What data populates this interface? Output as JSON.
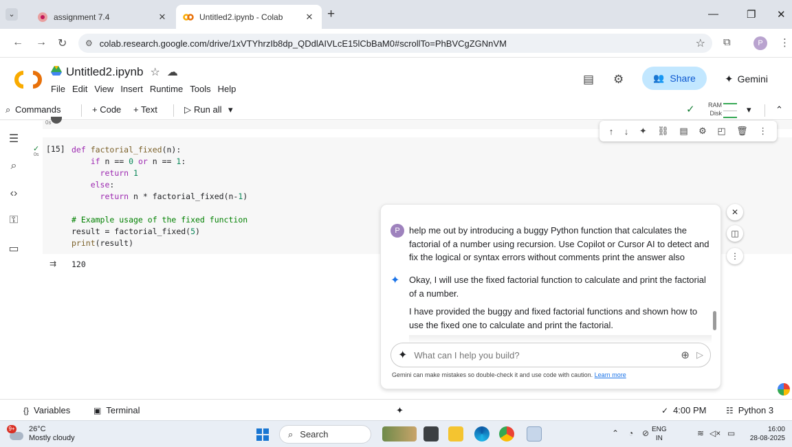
{
  "browser": {
    "tabs": [
      {
        "title": "assignment 7.4",
        "active": false
      },
      {
        "title": "Untitled2.ipynb - Colab",
        "active": true
      }
    ],
    "url": "colab.research.google.com/drive/1xVTYhrzIb8dp_QDdlAIVLcE15lCbBaM0#scrollTo=PhBVCgZGNnVM",
    "profile_initial": "P"
  },
  "colab": {
    "title": "Untitled2.ipynb",
    "menu": [
      "File",
      "Edit",
      "View",
      "Insert",
      "Runtime",
      "Tools",
      "Help"
    ],
    "share_label": "Share",
    "gemini_label": "Gemini"
  },
  "toolbar": {
    "commands": "Commands",
    "add_code": "+ Code",
    "add_text": "+ Text",
    "run_all": "Run all",
    "ram_label": "RAM",
    "disk_label": "Disk"
  },
  "cell": {
    "prev_time": "0s",
    "exec_count": "[15]",
    "run_time": "0s",
    "output": "120"
  },
  "gemini": {
    "user_initial": "P",
    "user_message": "help me out by introducing a buggy Python function that calculates the factorial of a number using recursion. Use Copilot or Cursor AI to detect and fix the logical or syntax errors without comments print the answer also",
    "reply_1": "Okay, I will use the fixed factorial function to calculate and print the factorial of a number.",
    "reply_2": "I have provided the buggy and fixed factorial functions and shown how to use the fixed one to calculate and print the factorial.",
    "input_placeholder": "What can I help you build?",
    "disclaimer": "Gemini can make mistakes so double-check it and use code with caution.",
    "learn_more": "Learn more"
  },
  "statusbar": {
    "variables": "Variables",
    "terminal": "Terminal",
    "time": "4:00 PM",
    "runtime": "Python 3"
  },
  "taskbar": {
    "weather_badge": "9+",
    "temperature": "26°C",
    "weather_desc": "Mostly cloudy",
    "search_label": "Search",
    "lang_1": "ENG",
    "lang_2": "IN",
    "clock_time": "16:00",
    "clock_date": "28-08-2025"
  },
  "colors": {
    "share_bg": "#c2e7ff",
    "gemini_accent": "#1a73e8",
    "success_green": "#188038"
  }
}
